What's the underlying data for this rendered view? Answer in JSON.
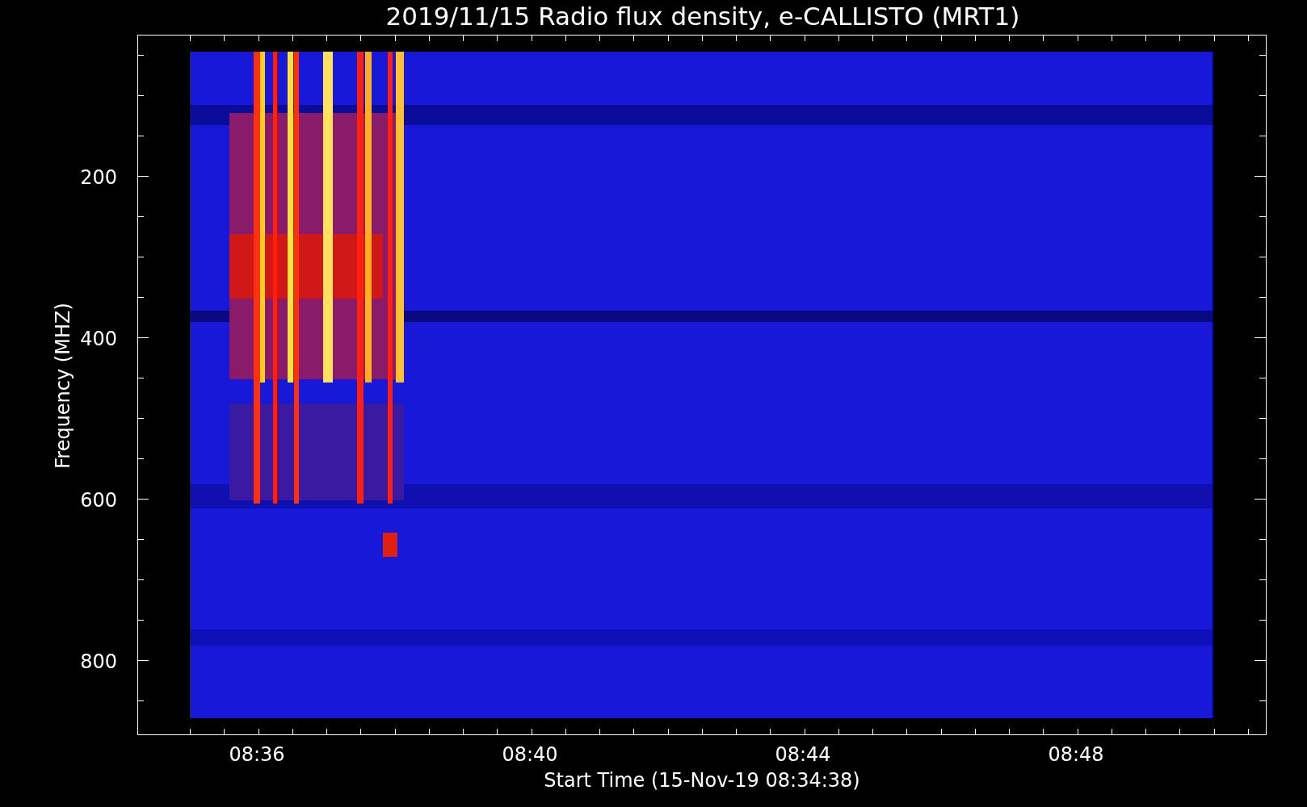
{
  "title": "2019/11/15  Radio flux density, e-CALLISTO (MRT1)",
  "y_axis": {
    "label": "Frequency (MHZ)",
    "tick_labels": [
      "200",
      "400",
      "600",
      "800"
    ]
  },
  "x_axis": {
    "label": "Start Time (15-Nov-19 08:34:38)",
    "tick_labels": [
      "08:36",
      "08:40",
      "08:44",
      "08:48"
    ]
  }
}
